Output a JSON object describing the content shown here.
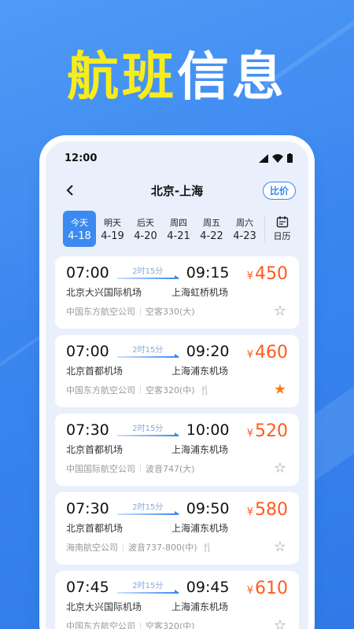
{
  "headline": {
    "part1": "航班",
    "part2": "信息"
  },
  "status": {
    "time": "12:00"
  },
  "nav": {
    "title": "北京-上海",
    "compare": "比价"
  },
  "dates": [
    {
      "day": "今天",
      "date": "4-18",
      "active": true
    },
    {
      "day": "明天",
      "date": "4-19"
    },
    {
      "day": "后天",
      "date": "4-20"
    },
    {
      "day": "周四",
      "date": "4-21"
    },
    {
      "day": "周五",
      "date": "4-22"
    },
    {
      "day": "周六",
      "date": "4-23"
    }
  ],
  "calendar": {
    "label": "日历"
  },
  "flights": [
    {
      "dep_time": "07:00",
      "arr_time": "09:15",
      "duration": "2时15分",
      "dep_airport": "北京大兴国际机场",
      "arr_airport": "上海虹桥机场",
      "airline": "中国东方航空公司",
      "aircraft": "空客330(大)",
      "price": "450",
      "meal": false,
      "starred": false
    },
    {
      "dep_time": "07:00",
      "arr_time": "09:20",
      "duration": "2时15分",
      "dep_airport": "北京首都机场",
      "arr_airport": "上海浦东机场",
      "airline": "中国东方航空公司",
      "aircraft": "空客320(中)",
      "price": "460",
      "meal": true,
      "starred": true
    },
    {
      "dep_time": "07:30",
      "arr_time": "10:00",
      "duration": "2时15分",
      "dep_airport": "北京首都机场",
      "arr_airport": "上海浦东机场",
      "airline": "中国国际航空公司",
      "aircraft": "波音747(大)",
      "price": "520",
      "meal": false,
      "starred": false
    },
    {
      "dep_time": "07:30",
      "arr_time": "09:50",
      "duration": "2时15分",
      "dep_airport": "北京首都机场",
      "arr_airport": "上海浦东机场",
      "airline": "海南航空公司",
      "aircraft": "波音737-800(中)",
      "price": "580",
      "meal": true,
      "starred": false
    },
    {
      "dep_time": "07:45",
      "arr_time": "09:45",
      "duration": "2时15分",
      "dep_airport": "北京大兴国际机场",
      "arr_airport": "上海浦东机场",
      "airline": "中国东方航空公司",
      "aircraft": "空客320(中)",
      "price": "610",
      "meal": false,
      "starred": false
    }
  ],
  "currency": "¥",
  "colors": {
    "accent": "#3a86ef",
    "price": "#ff5a1f",
    "star_on": "#ff7a1a",
    "headline_yellow": "#f8ec1a"
  }
}
